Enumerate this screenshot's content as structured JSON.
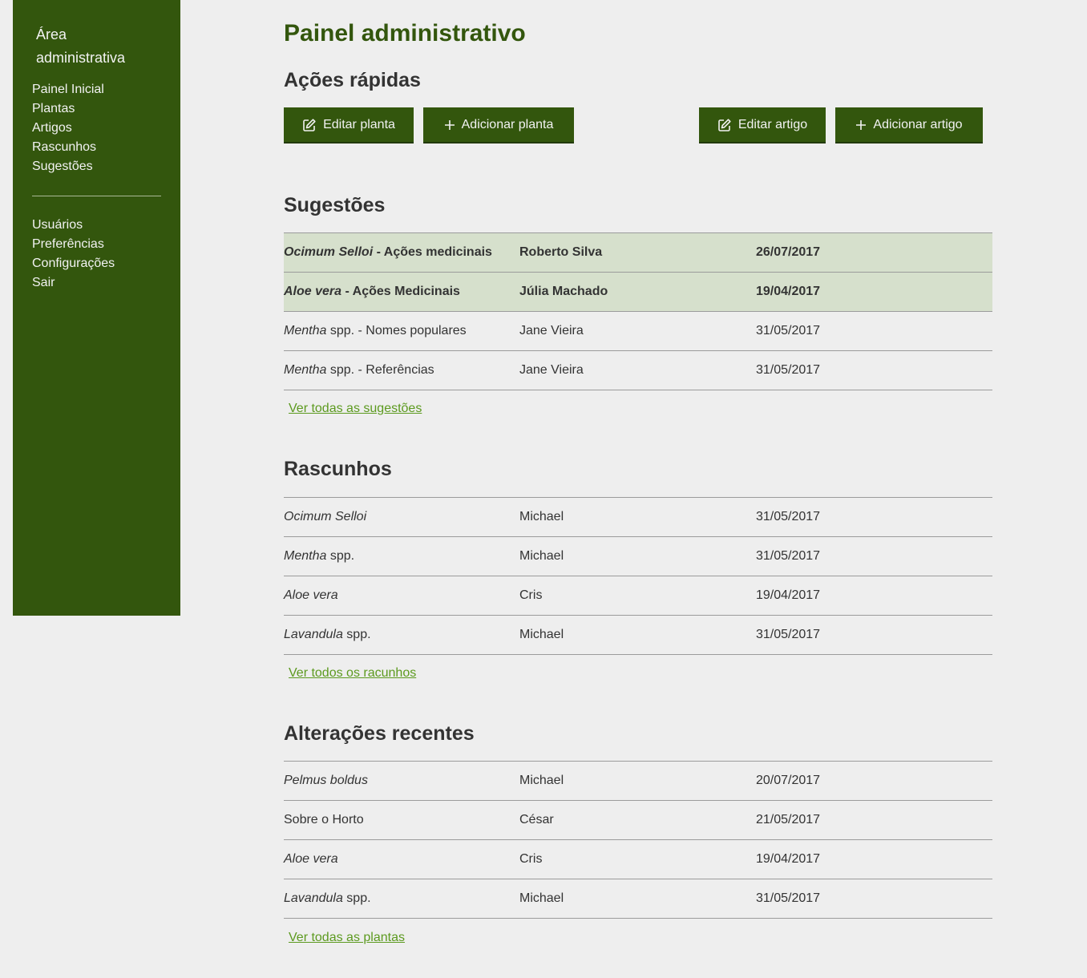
{
  "sidebar": {
    "title": "Área administrativa",
    "nav_primary": [
      "Painel Inicial",
      "Plantas",
      "Artigos",
      "Rascunhos",
      "Sugestões"
    ],
    "nav_secondary": [
      "Usuários",
      "Preferências",
      "Configurações",
      "Sair"
    ]
  },
  "page": {
    "title": "Painel administrativo"
  },
  "quick_actions": {
    "heading": "Ações rápidas",
    "buttons": [
      {
        "label": "Editar planta",
        "icon": "edit-icon"
      },
      {
        "label": "Adicionar planta",
        "icon": "plus-icon"
      },
      {
        "label": "Editar artigo",
        "icon": "edit-icon"
      },
      {
        "label": "Adicionar artigo",
        "icon": "plus-icon"
      }
    ]
  },
  "suggestions": {
    "heading": "Sugestões",
    "rows": [
      {
        "name_italic": "Ocimum Selloi",
        "name_rest": " - Ações medicinais",
        "author": "Roberto Silva",
        "date": "26/07/2017",
        "highlighted": true
      },
      {
        "name_italic": "Aloe vera",
        "name_rest": " - Ações Medicinais",
        "author": "Júlia Machado",
        "date": "19/04/2017",
        "highlighted": true
      },
      {
        "name_italic": "Mentha",
        "name_rest": " spp. - Nomes populares",
        "author": "Jane Vieira",
        "date": "31/05/2017",
        "highlighted": false
      },
      {
        "name_italic": "Mentha",
        "name_rest": " spp. - Referências",
        "author": "Jane Vieira",
        "date": "31/05/2017",
        "highlighted": false
      }
    ],
    "link": "Ver todas as sugestões"
  },
  "drafts": {
    "heading": "Rascunhos",
    "rows": [
      {
        "name_italic": "Ocimum Selloi",
        "name_rest": "",
        "author": "Michael",
        "date": "31/05/2017"
      },
      {
        "name_italic": "Mentha",
        "name_rest": " spp.",
        "author": "Michael",
        "date": "31/05/2017"
      },
      {
        "name_italic": "Aloe vera",
        "name_rest": "",
        "author": "Cris",
        "date": "19/04/2017"
      },
      {
        "name_italic": "Lavandula",
        "name_rest": " spp.",
        "author": "Michael",
        "date": "31/05/2017"
      }
    ],
    "link": "Ver todos os racunhos"
  },
  "recent": {
    "heading": "Alterações recentes",
    "rows": [
      {
        "name_italic": "Pelmus boldus",
        "name_rest": "",
        "author": "Michael",
        "date": "20/07/2017"
      },
      {
        "name_italic": "",
        "name_rest": "Sobre o Horto",
        "author": "César",
        "date": "21/05/2017"
      },
      {
        "name_italic": "Aloe vera",
        "name_rest": "",
        "author": "Cris",
        "date": "19/04/2017"
      },
      {
        "name_italic": "Lavandula",
        "name_rest": " spp.",
        "author": "Michael",
        "date": "31/05/2017"
      }
    ],
    "link": "Ver todas as plantas"
  },
  "colors": {
    "sidebar_bg": "#33560d",
    "page_bg": "#eeeeee",
    "highlight_row": "#d6e0cc",
    "link": "#5c9a1f"
  }
}
